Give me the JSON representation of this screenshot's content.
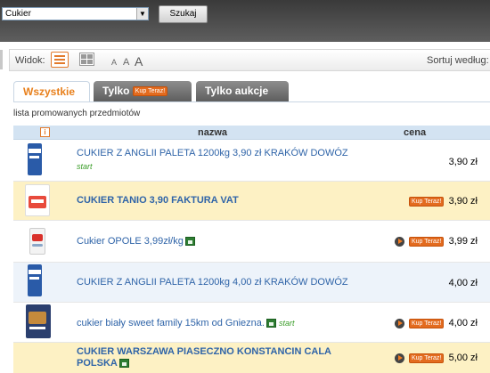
{
  "search": {
    "category_value": "Cukier",
    "button_label": "Szukaj"
  },
  "toolbar": {
    "view_label": "Widok:",
    "font_small": "A",
    "font_medium": "A",
    "font_large": "A",
    "sort_label": "Sortuj według:"
  },
  "tabs": [
    {
      "label": "Wszystkie",
      "active": true
    },
    {
      "label": "Tylko",
      "badge": "Kup Teraz!"
    },
    {
      "label": "Tylko aukcje"
    }
  ],
  "list": {
    "promo_label": "lista promowanych przedmiotów",
    "info_icon": "i",
    "columns": {
      "name": "nazwa",
      "price": "cena"
    },
    "items": [
      {
        "title": "CUKIER Z ANGLII PALETA 1200kg 3,90 zł KRAKÓW DOWÓZ",
        "start": "start",
        "price": "3,90 zł",
        "kup": ""
      },
      {
        "title": "CUKIER TANIO 3,90 FAKTURA VAT",
        "price": "3,90 zł",
        "kup": "Kup Teraz!"
      },
      {
        "title": "Cukier OPOLE 3,99zł/kg",
        "price": "3,99 zł",
        "kup": "Kup Teraz!"
      },
      {
        "title": "CUKIER Z ANGLII PALETA 1200kg 4,00 zł KRAKÓW DOWÓZ",
        "price": "4,00 zł",
        "kup": ""
      },
      {
        "title": "cukier biały sweet family 15km od Gniezna.",
        "start": "start",
        "price": "4,00 zł",
        "kup": "Kup Teraz!"
      },
      {
        "title_line1": "CUKIER WARSZAWA PIASECZNO KONSTANCIN CALA",
        "title_line2": "POLSKA",
        "price": "5,00 zł",
        "kup": "Kup Teraz!"
      }
    ]
  },
  "colors": {
    "accent": "#e8801c",
    "link": "#2f64a8",
    "promo_row": "#fdf1c4",
    "header": "#d3e3f2"
  }
}
